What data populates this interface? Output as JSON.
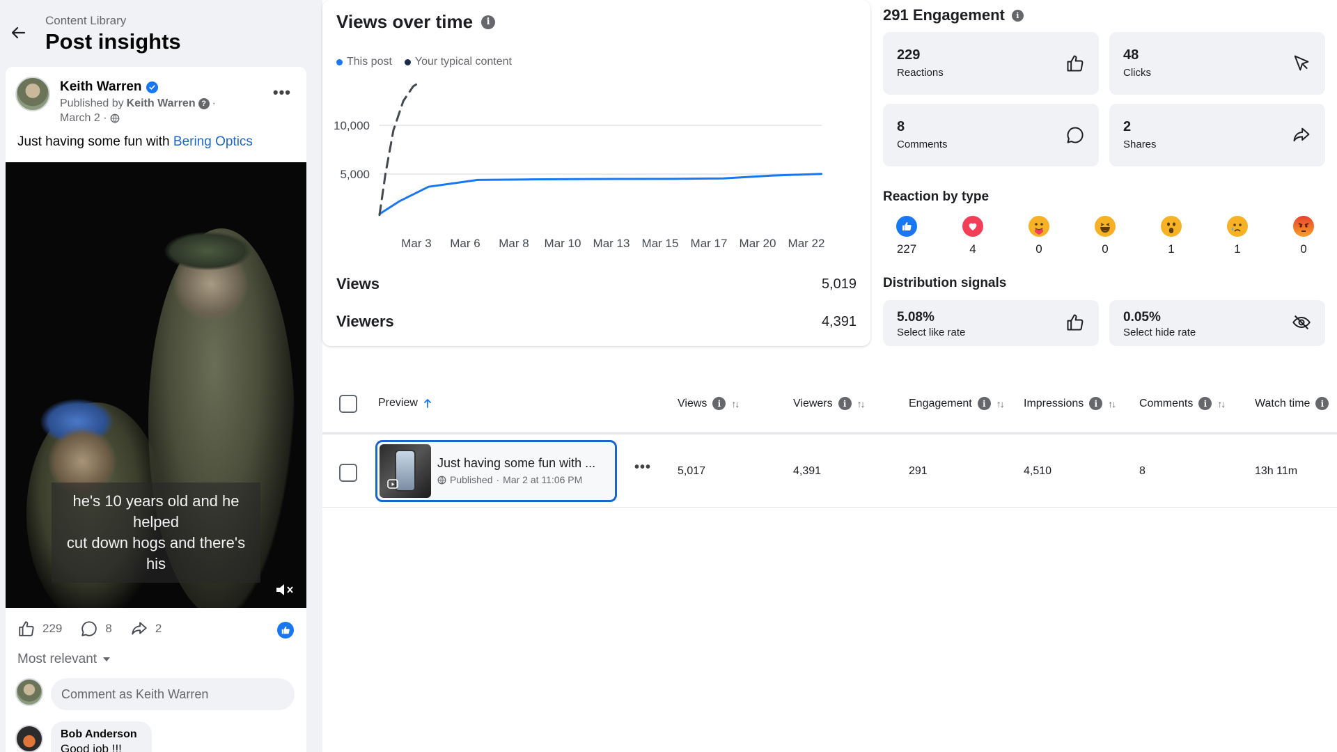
{
  "header": {
    "breadcrumb": "Content Library",
    "title": "Post insights"
  },
  "post": {
    "author": "Keith Warren",
    "published_prefix": "Published by",
    "published_by": "Keith Warren",
    "date": "March 2 ·",
    "caption_text": "Just having some fun with ",
    "caption_link": "Bering Optics",
    "video_subtitle_1": "he's 10 years old and he helped",
    "video_subtitle_2": "cut down hogs and there's his",
    "reactions_count": "229",
    "comments_count": "8",
    "shares_count": "2",
    "sort_label": "Most relevant",
    "comment_placeholder": "Comment as Keith Warren",
    "first_comment_author": "Bob Anderson",
    "first_comment_text": "Good job !!!"
  },
  "views_card": {
    "title": "Views over time",
    "legend_this_post": "This post",
    "legend_typical": "Your typical content",
    "views_label": "Views",
    "views_value": "5,019",
    "viewers_label": "Viewers",
    "viewers_value": "4,391"
  },
  "chart_data": {
    "type": "line",
    "x": [
      "Mar 3",
      "Mar 6",
      "Mar 8",
      "Mar 10",
      "Mar 13",
      "Mar 15",
      "Mar 17",
      "Mar 20",
      "Mar 22"
    ],
    "ylim": [
      0,
      15000
    ],
    "yticks": [
      "10,000",
      "5,000"
    ],
    "ytick_values": [
      10000,
      5000
    ],
    "series": [
      {
        "name": "This post",
        "color": "#1877f2",
        "style": "solid",
        "points": [
          [
            0,
            900
          ],
          [
            0.4,
            2200
          ],
          [
            1,
            3700
          ],
          [
            2,
            4400
          ],
          [
            3,
            4450
          ],
          [
            4,
            4480
          ],
          [
            5,
            4500
          ],
          [
            6,
            4510
          ],
          [
            7,
            4560
          ],
          [
            8,
            4850
          ],
          [
            9,
            5019
          ]
        ]
      },
      {
        "name": "Your typical content",
        "color": "#444950",
        "style": "dashed",
        "points": [
          [
            0,
            800
          ],
          [
            0.15,
            5000
          ],
          [
            0.35,
            9500
          ],
          [
            0.6,
            12500
          ],
          [
            0.85,
            14000
          ],
          [
            1.0,
            14400
          ]
        ]
      }
    ],
    "grid": true,
    "legend": "top-left"
  },
  "engagement": {
    "title": "291 Engagement",
    "cards": [
      {
        "value": "229",
        "label": "Reactions",
        "icon": "thumbs-up-icon"
      },
      {
        "value": "48",
        "label": "Clicks",
        "icon": "cursor-icon"
      },
      {
        "value": "8",
        "label": "Comments",
        "icon": "comment-icon"
      },
      {
        "value": "2",
        "label": "Shares",
        "icon": "share-icon"
      }
    ],
    "reactions_title": "Reaction by type",
    "reactions": [
      {
        "name": "like",
        "count": "227",
        "color": "#1877f2"
      },
      {
        "name": "love",
        "count": "4",
        "color": "#f33e58"
      },
      {
        "name": "care",
        "count": "0",
        "color": "#f7b125"
      },
      {
        "name": "haha",
        "count": "0",
        "color": "#f7b125"
      },
      {
        "name": "wow",
        "count": "1",
        "color": "#f7b125"
      },
      {
        "name": "sad",
        "count": "1",
        "color": "#f7b125"
      },
      {
        "name": "angry",
        "count": "0",
        "color": "#e9710f"
      }
    ],
    "distribution_title": "Distribution signals",
    "distribution": [
      {
        "value": "5.08%",
        "label": "Select like rate",
        "icon": "thumbs-up-icon"
      },
      {
        "value": "0.05%",
        "label": "Select hide rate",
        "icon": "eye-off-icon"
      }
    ]
  },
  "table": {
    "columns": [
      "Preview",
      "Views",
      "Viewers",
      "Engagement",
      "Impressions",
      "Comments",
      "Watch time"
    ],
    "row": {
      "title": "Just having some fun with ...",
      "status": "Published",
      "date": "Mar 2 at 11:06 PM",
      "views": "5,017",
      "viewers": "4,391",
      "engagement": "291",
      "impressions": "4,510",
      "comments": "8",
      "watch_time": "13h 11m"
    }
  },
  "colors": {
    "accent": "#1877f2",
    "link": "#1b66c9",
    "panel_bg": "#f0f2f5"
  }
}
